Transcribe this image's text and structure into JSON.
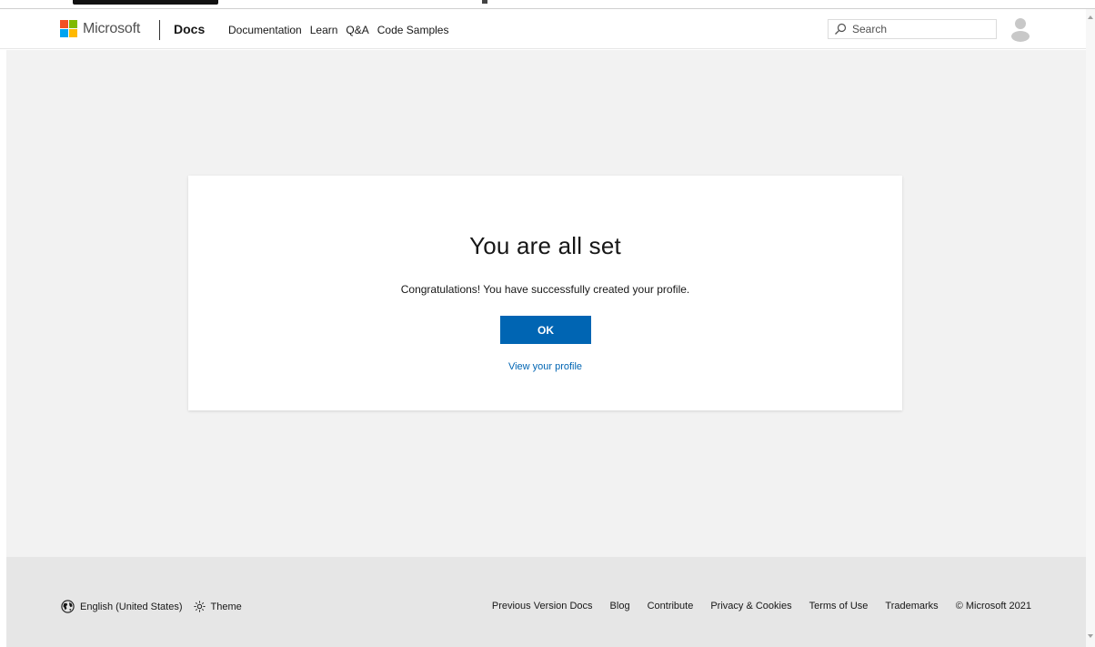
{
  "header": {
    "logo_text": "Microsoft",
    "site_name": "Docs",
    "nav": [
      "Documentation",
      "Learn",
      "Q&A",
      "Code Samples"
    ],
    "search_placeholder": "Search"
  },
  "card": {
    "title": "You are all set",
    "message": "Congratulations! You have successfully created your profile.",
    "ok_label": "OK",
    "profile_link": "View your profile"
  },
  "footer": {
    "language": "English (United States)",
    "theme": "Theme",
    "links": [
      "Previous Version Docs",
      "Blog",
      "Contribute",
      "Privacy & Cookies",
      "Terms of Use",
      "Trademarks"
    ],
    "copyright": "© Microsoft 2021"
  },
  "colors": {
    "accent": "#0065b3",
    "page_background": "#f2f2f2",
    "footer_background": "#e6e6e6"
  },
  "icons": [
    "microsoft-logo-icon",
    "search-icon",
    "avatar-icon",
    "globe-icon",
    "theme-sun-icon"
  ]
}
